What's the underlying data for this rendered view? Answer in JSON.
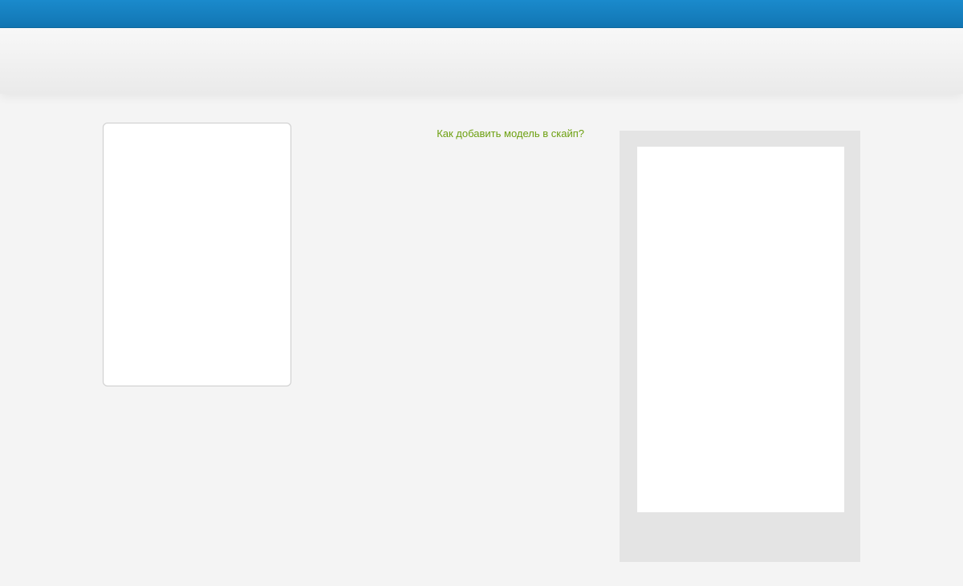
{
  "main": {
    "help_link_text": "Как добавить модель в скайп?"
  }
}
